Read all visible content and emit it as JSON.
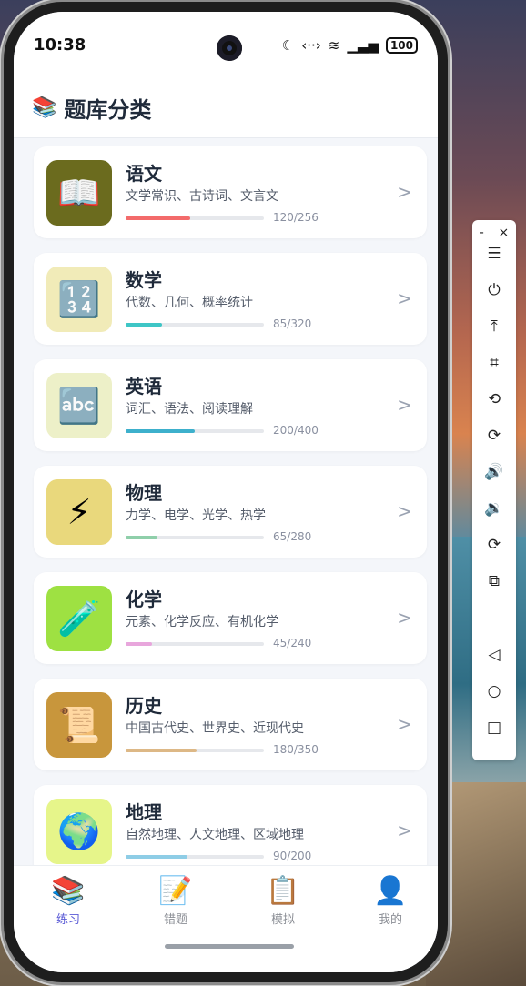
{
  "status": {
    "time": "10:38",
    "battery": "100"
  },
  "header": {
    "title": "题库分类",
    "icon": "books-icon"
  },
  "subjects": [
    {
      "name": "语文",
      "desc": "文学常识、古诗词、文言文",
      "done": 120,
      "total": 256,
      "count": "120/256",
      "emoji": "📖",
      "bg": "#6b6b1e",
      "bar": "#f36b6b"
    },
    {
      "name": "数学",
      "desc": "代数、几何、概率统计",
      "done": 85,
      "total": 320,
      "count": "85/320",
      "emoji": "🔢",
      "bg": "#f1ebb8",
      "bar": "#3ec6c6"
    },
    {
      "name": "英语",
      "desc": "词汇、语法、阅读理解",
      "done": 200,
      "total": 400,
      "count": "200/400",
      "emoji": "🔤",
      "bg": "#edf0c8",
      "bar": "#3db0cc"
    },
    {
      "name": "物理",
      "desc": "力学、电学、光学、热学",
      "done": 65,
      "total": 280,
      "count": "65/280",
      "emoji": "⚡",
      "bg": "#e9d87c",
      "bar": "#8fcfaa"
    },
    {
      "name": "化学",
      "desc": "元素、化学反应、有机化学",
      "done": 45,
      "total": 240,
      "count": "45/240",
      "emoji": "🧪",
      "bg": "#9ee142",
      "bar": "#e8a6dc"
    },
    {
      "name": "历史",
      "desc": "中国古代史、世界史、近现代史",
      "done": 180,
      "total": 350,
      "count": "180/350",
      "emoji": "📜",
      "bg": "#c8963c",
      "bar": "#ddb886"
    },
    {
      "name": "地理",
      "desc": "自然地理、人文地理、区域地理",
      "done": 90,
      "total": 200,
      "count": "90/200",
      "emoji": "🌍",
      "bg": "#e6f58a",
      "bar": "#8ecde6"
    }
  ],
  "nav": [
    {
      "label": "练习",
      "emoji": "📚",
      "active": true
    },
    {
      "label": "错题",
      "emoji": "📝",
      "active": false
    },
    {
      "label": "模拟",
      "emoji": "📋",
      "active": false
    },
    {
      "label": "我的",
      "emoji": "👤",
      "active": false
    }
  ],
  "toolbar": {
    "minimize": "-",
    "close": "×",
    "buttons": [
      {
        "name": "menu-icon",
        "glyph": "☰"
      },
      {
        "name": "power-icon",
        "glyph": "⏻"
      },
      {
        "name": "pin-top-icon",
        "glyph": "⤒"
      },
      {
        "name": "crop-icon",
        "glyph": "⌗"
      },
      {
        "name": "rotate-left-icon",
        "glyph": "⟲"
      },
      {
        "name": "rotate-right-icon",
        "glyph": "⟳"
      },
      {
        "name": "volume-up-icon",
        "glyph": "🔊"
      },
      {
        "name": "volume-down-icon",
        "glyph": "🔉"
      },
      {
        "name": "rotate-device-icon",
        "glyph": "⟳"
      },
      {
        "name": "screen-mirror-icon",
        "glyph": "⧉"
      },
      {
        "name": "back-icon",
        "glyph": "◁"
      },
      {
        "name": "home-icon",
        "glyph": "○"
      },
      {
        "name": "recents-icon",
        "glyph": "□"
      }
    ]
  }
}
